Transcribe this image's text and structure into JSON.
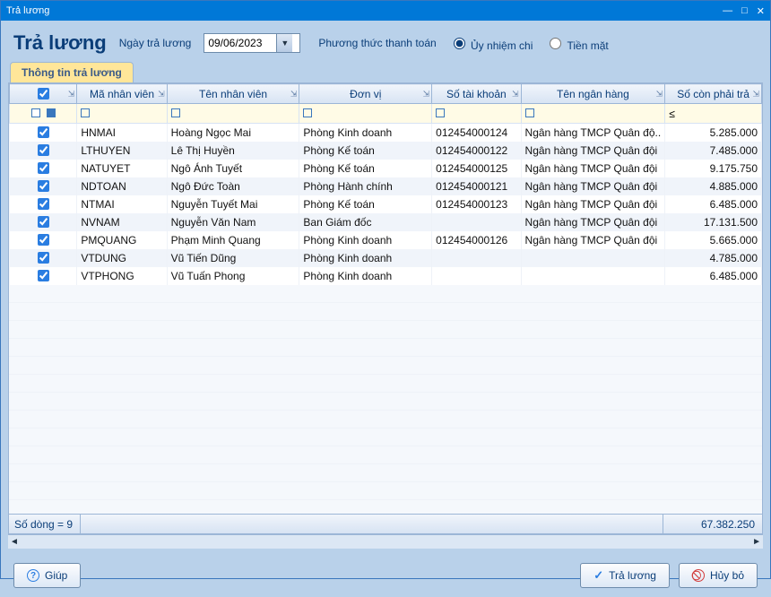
{
  "window": {
    "title": "Trả lương"
  },
  "header": {
    "heading": "Trả lương",
    "date_label": "Ngày trả lương",
    "date_value": "09/06/2023",
    "payment_method_label": "Phương thức thanh toán",
    "radio_transfer": "Ủy nhiệm chi",
    "radio_cash": "Tiền mặt"
  },
  "tab": {
    "label": "Thông tin trả lương"
  },
  "columns": {
    "check": "",
    "code": "Mã nhân viên",
    "name": "Tên nhân viên",
    "dept": "Đơn vị",
    "acct": "Số tài khoản",
    "bank": "Tên ngân hàng",
    "amt": "Số còn phải trả"
  },
  "filter_amt_op": "≤",
  "rows": [
    {
      "code": "HNMAI",
      "name": "Hoàng Ngọc Mai",
      "dept": "Phòng Kinh doanh",
      "acct": "012454000124",
      "bank": "Ngân hàng TMCP Quân độ..",
      "amt": "5.285.000"
    },
    {
      "code": "LTHUYEN",
      "name": "Lê Thị Huyền",
      "dept": "Phòng Kế toán",
      "acct": "012454000122",
      "bank": "Ngân hàng TMCP Quân đội",
      "amt": "7.485.000"
    },
    {
      "code": "NATUYET",
      "name": "Ngô Ánh Tuyết",
      "dept": "Phòng Kế toán",
      "acct": "012454000125",
      "bank": "Ngân hàng TMCP Quân đội",
      "amt": "9.175.750"
    },
    {
      "code": "NDTOAN",
      "name": "Ngô Đức Toàn",
      "dept": "Phòng Hành chính",
      "acct": "012454000121",
      "bank": "Ngân hàng TMCP Quân đội",
      "amt": "4.885.000"
    },
    {
      "code": "NTMAI",
      "name": "Nguyễn Tuyết Mai",
      "dept": "Phòng Kế toán",
      "acct": "012454000123",
      "bank": "Ngân hàng TMCP Quân đội",
      "amt": "6.485.000"
    },
    {
      "code": "NVNAM",
      "name": "Nguyễn Văn Nam",
      "dept": "Ban Giám đốc",
      "acct": "",
      "bank": "Ngân hàng TMCP Quân đội",
      "amt": "17.131.500"
    },
    {
      "code": "PMQUANG",
      "name": "Phạm Minh Quang",
      "dept": "Phòng Kinh doanh",
      "acct": "012454000126",
      "bank": "Ngân hàng TMCP Quân đội",
      "amt": "5.665.000"
    },
    {
      "code": "VTDUNG",
      "name": "Vũ Tiến Dũng",
      "dept": "Phòng Kinh doanh",
      "acct": "",
      "bank": "",
      "amt": "4.785.000"
    },
    {
      "code": "VTPHONG",
      "name": "Vũ Tuấn Phong",
      "dept": "Phòng Kinh doanh",
      "acct": "",
      "bank": "",
      "amt": "6.485.000"
    }
  ],
  "status": {
    "rowcount": "Số dòng = 9",
    "total": "67.382.250"
  },
  "footer": {
    "help": "Giúp",
    "pay": "Trả lương",
    "cancel": "Hủy bỏ"
  }
}
